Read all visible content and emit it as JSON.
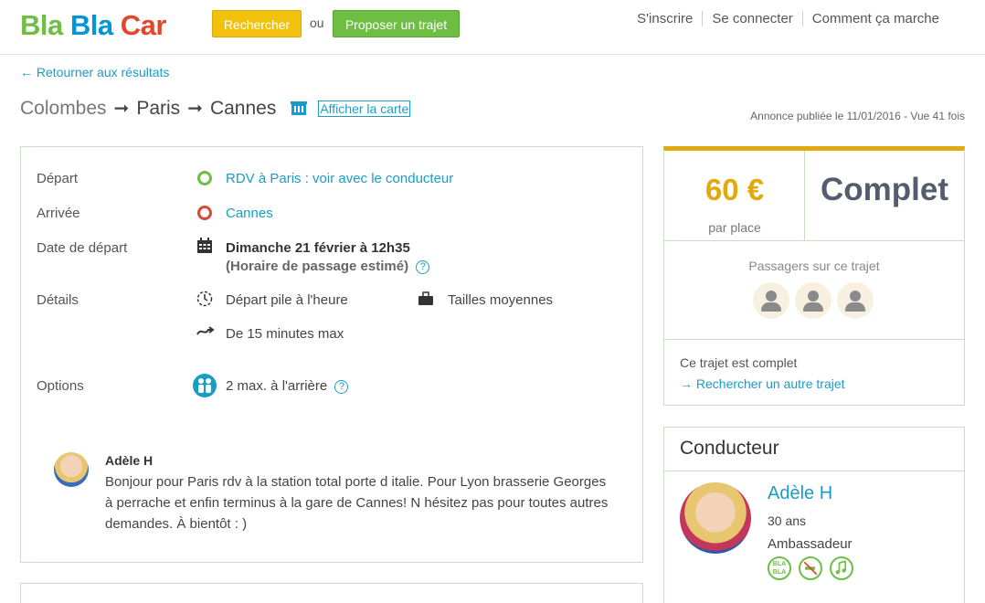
{
  "header": {
    "logo": {
      "part1": "Bla",
      "part2": "Bla",
      "part3": "Car"
    },
    "search_label": "Rechercher",
    "or_label": "ou",
    "offer_label": "Proposer un trajet",
    "nav": [
      "S'inscrire",
      "Se connecter",
      "Comment ça marche"
    ]
  },
  "back_link": "← Retourner aux résultats",
  "route": {
    "from": "Colombes",
    "via": "Paris",
    "to": "Cannes",
    "map_link": "Afficher la carte"
  },
  "published": "Annonce publiée le 11/01/2016 - Vue 41 fois",
  "details": {
    "departure_label": "Départ",
    "departure_value": "RDV à Paris : voir avec le conducteur",
    "arrival_label": "Arrivée",
    "arrival_value": "Cannes",
    "date_label": "Date de départ",
    "date_value": "Dimanche 21 février à 12h35",
    "date_note": "(Horaire de passage estimé)",
    "details_label": "Détails",
    "punctuality": "Départ pile à l'heure",
    "luggage": "Tailles moyennes",
    "detour": "De 15 minutes max",
    "options_label": "Options",
    "options_value": "2 max. à l'arrière"
  },
  "comment": {
    "author": "Adèle H",
    "text": "Bonjour pour Paris rdv à la station total porte d italie. Pour Lyon brasserie Georges à perrache et enfin terminus à la gare de Cannes! N hésitez pas pour toutes autres demandes. À bientôt : )"
  },
  "pricing": {
    "price": "60 €",
    "per_seat": "par place",
    "status": "Complet",
    "passengers_title": "Passagers sur ce trajet",
    "full_text": "Ce trajet est complet",
    "search_other": "→ Rechercher un autre trajet"
  },
  "driver": {
    "section_title": "Conducteur",
    "name": "Adèle H",
    "age": "30 ans",
    "role": "Ambassadeur",
    "badges": [
      "BLA BLA",
      "no-smoking-icon",
      "music-icon"
    ]
  },
  "colors": {
    "green": "#6ebe44",
    "blue": "#0096d6",
    "red": "#e5462b",
    "yellow": "#f2c10c",
    "link": "#1a9cc9"
  }
}
